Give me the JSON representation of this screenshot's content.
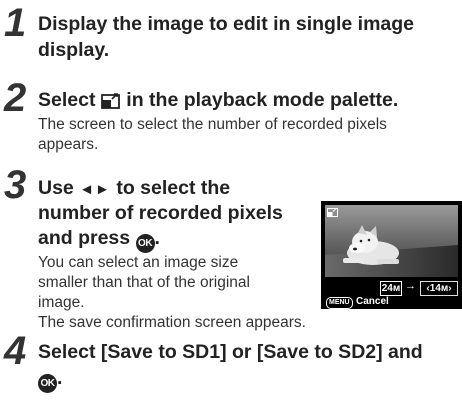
{
  "steps": [
    {
      "number": "1",
      "heading_line1": "Display the image to edit in single image",
      "heading_line2": "display."
    },
    {
      "number": "2",
      "heading_pre": "Select",
      "heading_icon": "resize-icon",
      "heading_post": "in the playback mode palette.",
      "body_line1": "The screen to select the number of recorded pixels",
      "body_line2": "appears."
    },
    {
      "number": "3",
      "heading_line1_pre": "Use",
      "heading_line1_arrows": "◄►",
      "heading_line1_post": "to select the",
      "heading_line2": "number of recorded pixels",
      "heading_line3": "and press",
      "heading_line3_icon": "OK",
      "body_line1": "You can select an image size",
      "body_line2": "smaller than that of the original",
      "body_line3": "image.",
      "body_line4": "The save confirmation screen appears."
    },
    {
      "number": "4",
      "heading_line1": "Select [Save to SD1] or [Save to SD2] and",
      "heading_line2_icon": "OK",
      "heading_line2_post": "."
    }
  ],
  "camera_screen": {
    "size_from": "24м",
    "arrow": "→",
    "size_to": "‹14м›",
    "menu_badge": "MENU",
    "cancel_label": "Cancel"
  }
}
